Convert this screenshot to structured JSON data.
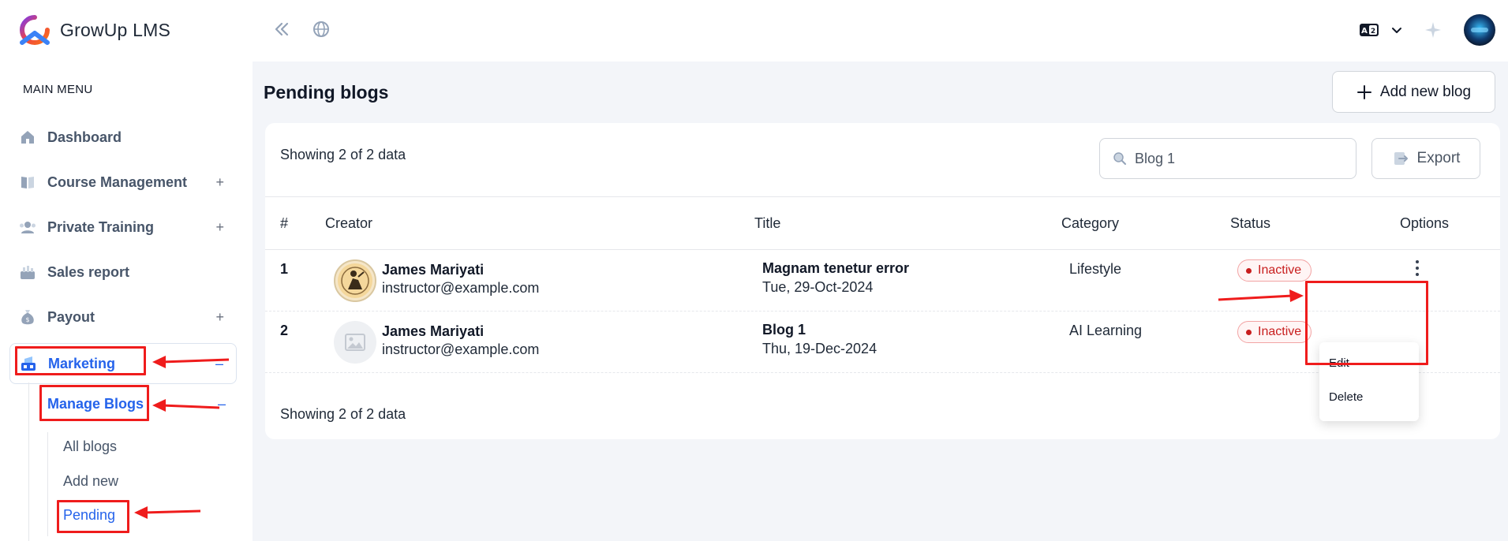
{
  "brand": {
    "name": "GrowUp LMS"
  },
  "sidebar": {
    "main_menu_label": "MAIN MENU",
    "items": [
      {
        "label": "Dashboard",
        "icon": "home-icon",
        "toggle": ""
      },
      {
        "label": "Course Management",
        "icon": "book-icon",
        "toggle": "+"
      },
      {
        "label": "Private Training",
        "icon": "users-icon",
        "toggle": "+"
      },
      {
        "label": "Sales report",
        "icon": "chart-icon",
        "toggle": ""
      },
      {
        "label": "Payout",
        "icon": "money-bag-icon",
        "toggle": "+"
      },
      {
        "label": "Marketing",
        "icon": "megaphone-icon",
        "toggle": "–",
        "active": true
      }
    ],
    "marketing_sub": {
      "label": "Manage Blogs",
      "toggle": "–",
      "children": [
        "All blogs",
        "Add new",
        "Pending"
      ],
      "active_child": "Pending"
    }
  },
  "topbar": {
    "icons": [
      "collapse-sidebar-icon",
      "globe-icon",
      "language-icon",
      "chevron-down-icon",
      "sparkle-icon",
      "avatar"
    ]
  },
  "page": {
    "title": "Pending blogs",
    "add_button_label": "Add new blog",
    "showing_top": "Showing 2 of 2 data",
    "showing_bottom": "Showing 2 of 2 data",
    "search": {
      "value": "Blog 1",
      "placeholder": "Search"
    },
    "export_label": "Export"
  },
  "table": {
    "columns": [
      "#",
      "Creator",
      "Title",
      "Category",
      "Status",
      "Options"
    ],
    "rows": [
      {
        "num": "1",
        "creator_name": "James Mariyati",
        "creator_email": "instructor@example.com",
        "title": "Magnam tenetur error",
        "date": "Tue, 29-Oct-2024",
        "category": "Lifestyle",
        "status": "Inactive"
      },
      {
        "num": "2",
        "creator_name": "James Mariyati",
        "creator_email": "instructor@example.com",
        "title": "Blog 1",
        "date": "Thu, 19-Dec-2024",
        "category": "AI Learning",
        "status": "Inactive"
      }
    ]
  },
  "options_menu": {
    "items": [
      "Edit",
      "Delete"
    ]
  },
  "colors": {
    "accent": "#2563eb",
    "danger": "#c81e1e",
    "annotation": "#ef1c1c",
    "content_bg": "#f3f5f9"
  }
}
